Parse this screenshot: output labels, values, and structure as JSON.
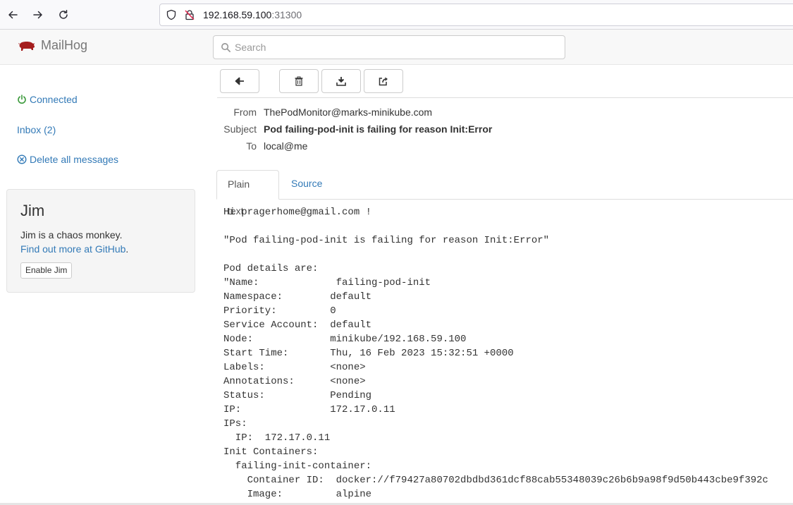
{
  "browser": {
    "url_host": "192.168.59.100",
    "url_port": ":31300"
  },
  "app": {
    "brand": "MailHog",
    "search_placeholder": "Search"
  },
  "sidebar": {
    "connected": "Connected",
    "inbox": "Inbox (2)",
    "delete_all": "Delete all messages",
    "jim": {
      "title": "Jim",
      "description": "Jim is a chaos monkey.",
      "link": "Find out more at GitHub",
      "link_suffix": ".",
      "button": "Enable Jim"
    }
  },
  "message": {
    "from_label": "From",
    "from": "ThePodMonitor@marks-minikube.com",
    "subject_label": "Subject",
    "subject": "Pod failing-pod-init is failing for reason Init:Error",
    "to_label": "To",
    "to": "local@me",
    "tabs": [
      "Plain text",
      "Source"
    ],
    "body_lines": [
      "Hi pragerhome@gmail.com !",
      "",
      "\"Pod failing-pod-init is failing for reason Init:Error\"",
      "",
      "Pod details are:",
      "\"Name:             failing-pod-init",
      "Namespace:        default",
      "Priority:         0",
      "Service Account:  default",
      "Node:             minikube/192.168.59.100",
      "Start Time:       Thu, 16 Feb 2023 15:32:51 +0000",
      "Labels:           <none>",
      "Annotations:      <none>",
      "Status:           Pending",
      "IP:               172.17.0.11",
      "IPs:",
      "  IP:  172.17.0.11",
      "Init Containers:",
      "  failing-init-container:",
      "    Container ID:  docker://f79427a80702dbdbd361dcf88cab55348039c26b6b9a98f9d50b443cbe9f392c",
      "    Image:         alpine"
    ]
  },
  "colors": {
    "link": "#337ab7",
    "connected_icon": "#3c9a3c",
    "brand_icon": "#a51d1d"
  }
}
